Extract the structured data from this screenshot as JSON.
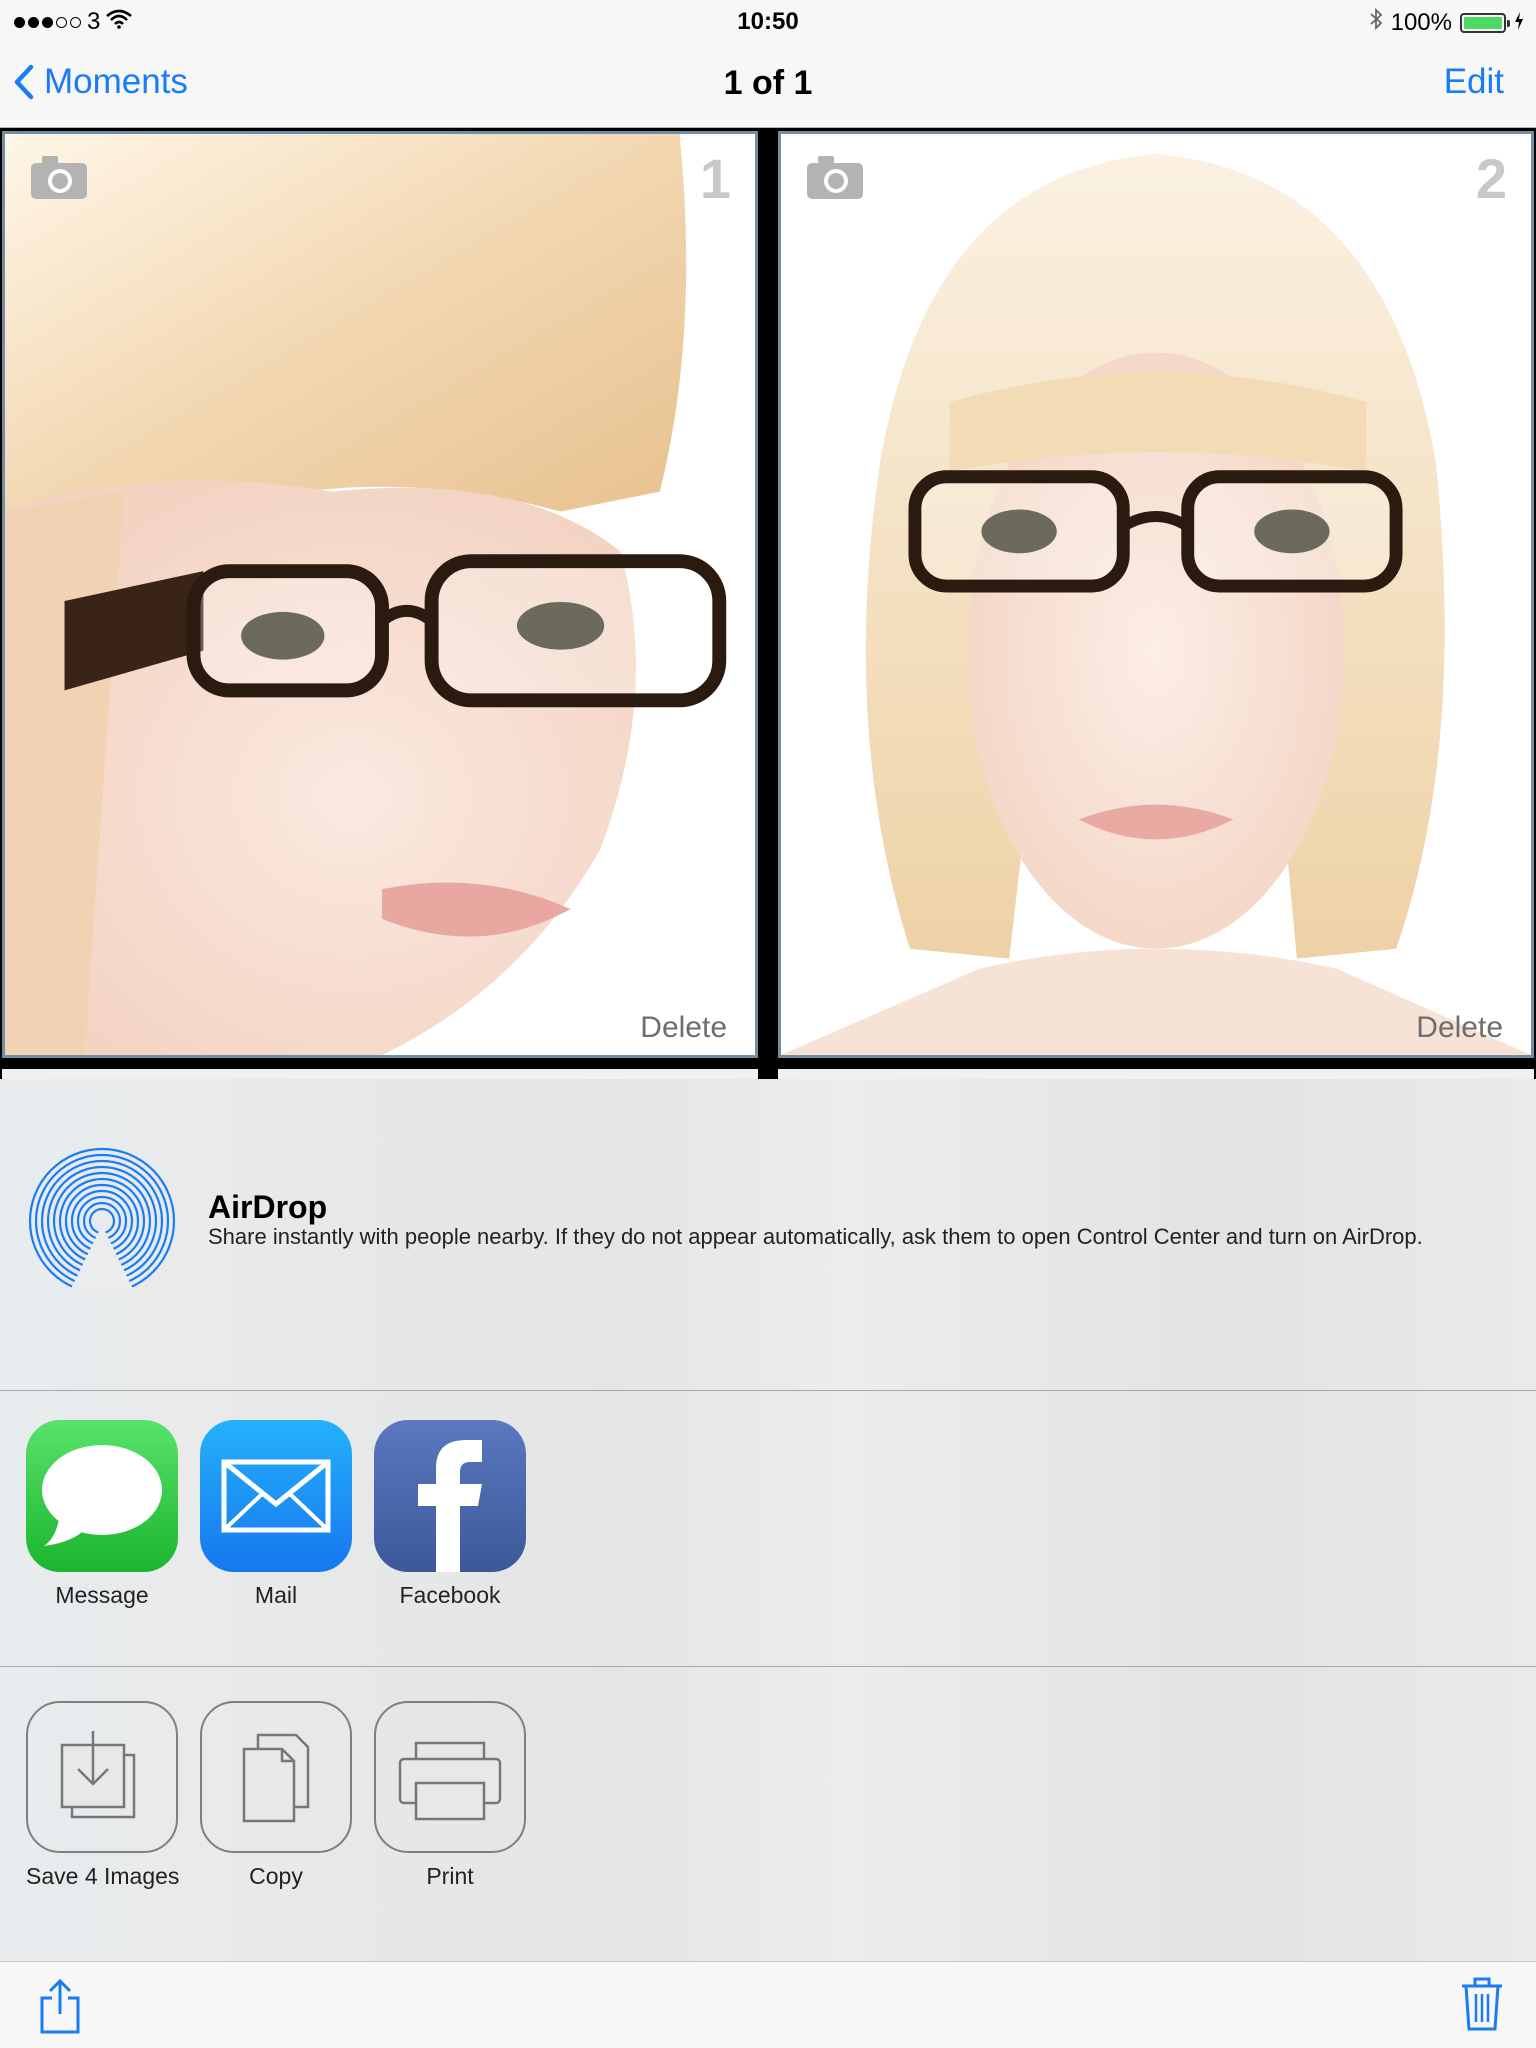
{
  "status_bar": {
    "carrier": "3",
    "time": "10:50",
    "battery": "100%",
    "battery_level": 1.0
  },
  "nav": {
    "back_label": "Moments",
    "title": "1 of 1",
    "edit_label": "Edit"
  },
  "photos": [
    {
      "number": "1",
      "delete_label": "Delete"
    },
    {
      "number": "2",
      "delete_label": "Delete"
    }
  ],
  "airdrop": {
    "title": "AirDrop",
    "description": "Share instantly with people nearby. If they do not appear automatically, ask them to open Control Center and turn on AirDrop."
  },
  "share_apps": [
    {
      "label": "Message",
      "icon": "message-icon"
    },
    {
      "label": "Mail",
      "icon": "mail-icon"
    },
    {
      "label": "Facebook",
      "icon": "facebook-icon"
    }
  ],
  "actions": [
    {
      "label": "Save 4 Images",
      "icon": "save-images-icon"
    },
    {
      "label": "Copy",
      "icon": "copy-icon"
    },
    {
      "label": "Print",
      "icon": "print-icon"
    }
  ],
  "toolbar": {
    "share_icon": "share-icon",
    "trash_icon": "trash-icon"
  },
  "colors": {
    "accent": "#1a7cf5",
    "photo_border": "#6f8ea8",
    "battery_fill": "#4cd964"
  }
}
